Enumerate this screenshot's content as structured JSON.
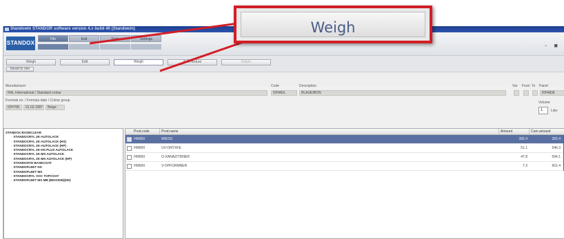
{
  "window": {
    "title": "Standowin STANDOR software version 4.x build 40 (Standowin)"
  },
  "app": {
    "logo": "STANDOX"
  },
  "ribbon": {
    "menu_tabs": [
      "File",
      "Edit",
      "Tools",
      "Settings"
    ],
    "sub_tabs": [
      "",
      "",
      "",
      ""
    ],
    "window_controls": "- ■"
  },
  "actions": {
    "buttons": [
      "Weigh",
      "Edit",
      "Weigh",
      "Add mixture",
      "Delete"
    ],
    "reset_button": "Reset to one"
  },
  "info": {
    "manufacturer_label": "Manufacturer",
    "manufacturer_value": "RAL International / Standard colour",
    "code_label": "Code",
    "code_value": "IDHADL",
    "description_label": "Description",
    "description_value": "BLAUEIBON",
    "var_label": "Var",
    "from_label": "From",
    "to_label": "To",
    "panel_label": "Panel",
    "panel_value": "IDHADE",
    "formula_label": "Formula no. / Formula date / Colour group",
    "formula_no": "IDH708",
    "formula_date": "01.02.1987",
    "colour_group": "Beige",
    "volume_label": "Volume",
    "volume_value": "1",
    "volume_unit": "Liter"
  },
  "tree": {
    "items": [
      {
        "label": "STANDOX BASECLEAR",
        "child": false
      },
      {
        "label": "STANDOCRYL 2K-AUTOLACK",
        "child": true
      },
      {
        "label": "STANDOCRYL 2K-AUTOLACK (HS)",
        "child": true
      },
      {
        "label": "STANDOCRYL 2K-AUTOLACK (HP)",
        "child": true
      },
      {
        "label": "STANDOCRYL 2K-HS PLUS AUTOLACK",
        "child": true
      },
      {
        "label": "STANDOCRYL 2K-MS AUTOLACK",
        "child": true
      },
      {
        "label": "STANDOCRYL 2K-MS AUTOLACK (HP)",
        "child": true
      },
      {
        "label": "STANDOHYD BASECOAT",
        "child": true
      },
      {
        "label": "STANDOFLEET HS",
        "child": true
      },
      {
        "label": "STANDOFLEET MS",
        "child": true
      },
      {
        "label": "STANDOCRYL VOC TOPCOAT",
        "child": true
      },
      {
        "label": "STANDOFLEET MS MB (BIOCIDE)(HS)",
        "child": true
      }
    ]
  },
  "grid": {
    "headers": [
      "Prod.code",
      "Prod.name",
      "Amount",
      "Cum.amount"
    ],
    "rows": [
      {
        "code": "HM000",
        "name": "WEISS",
        "amount": "392.4",
        "cum": "392.4",
        "selected": true
      },
      {
        "code": "HM000",
        "name": "UV-ORYXFE",
        "amount": "51.1",
        "cum": "546.3",
        "selected": false
      },
      {
        "code": "HM000",
        "name": "O-XANAZITDNER",
        "amount": "47.8",
        "cum": "594.1",
        "selected": false
      },
      {
        "code": "HM000",
        "name": "V-OPFORMNER",
        "amount": "7.3",
        "cum": "601.4",
        "selected": false
      }
    ]
  },
  "callout": {
    "label": "Weigh"
  },
  "colors": {
    "callout_border": "#d31e26",
    "selection": "#5a70a3",
    "titlebar": "#1e3f8f"
  }
}
